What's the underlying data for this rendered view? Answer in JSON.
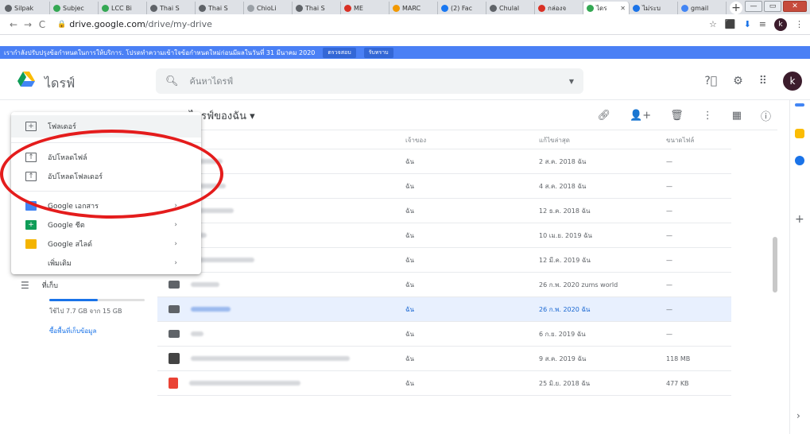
{
  "browser": {
    "tabs": [
      {
        "label": "Silpak",
        "color": "#5f6368"
      },
      {
        "label": "Subjec",
        "color": "#34a853"
      },
      {
        "label": "LCC Bi",
        "color": "#34a853"
      },
      {
        "label": "Thai S",
        "color": "#5f6368"
      },
      {
        "label": "Thai S",
        "color": "#5f6368"
      },
      {
        "label": "ChioLi",
        "color": "#9aa0a6"
      },
      {
        "label": "Thai S",
        "color": "#5f6368"
      },
      {
        "label": "ME",
        "color": "#d93025"
      },
      {
        "label": "MARC",
        "color": "#f29900"
      },
      {
        "label": "(2) Fac",
        "color": "#1877f2"
      },
      {
        "label": "Chulal",
        "color": "#5f6368"
      },
      {
        "label": "กล่องจ",
        "color": "#d93025"
      },
      {
        "label": "ไดร",
        "color": "#34a853"
      },
      {
        "label": "ไม่ระบ",
        "color": "#1a73e8"
      },
      {
        "label": "gmail",
        "color": "#4285f4"
      }
    ],
    "url_host": "drive.google.com",
    "url_path": "/drive/my-drive",
    "profile_letter": "k"
  },
  "notice": {
    "text": "เรากำลังปรับปรุงข้อกำหนดในการให้บริการ. โปรดทำความเข้าใจข้อกำหนดใหม่ก่อนมีผลในวันที่ 31 มีนาคม 2020",
    "review_label": "ตรวจสอบ",
    "dismiss_label": "รับทราบ"
  },
  "header": {
    "title": "ไดรฟ์",
    "search_placeholder": "ค้นหาไดรฟ์",
    "avatar_letter": "k"
  },
  "toolbar": {
    "breadcrumb": "ไดรฟ์ของฉัน"
  },
  "table": {
    "col_owner": "เจ้าของ",
    "col_modified": "แก้ไขล่าสุด",
    "col_size": "ขนาดไฟล์",
    "rows": [
      {
        "owner": "ฉัน",
        "modified": "2 ส.ค. 2018 ฉัน",
        "size": "—"
      },
      {
        "owner": "ฉัน",
        "modified": "4 ส.ค. 2018 ฉัน",
        "size": "—"
      },
      {
        "owner": "ฉัน",
        "modified": "12 ธ.ค. 2018 ฉัน",
        "size": "—"
      },
      {
        "owner": "ฉัน",
        "modified": "10 เม.ย. 2019 ฉัน",
        "size": "—"
      },
      {
        "owner": "ฉัน",
        "modified": "12 มี.ค. 2019 ฉัน",
        "size": "—"
      },
      {
        "owner": "ฉัน",
        "modified": "26 ก.พ. 2020 zums world",
        "size": "—"
      },
      {
        "owner": "ฉัน",
        "modified": "26 ก.พ. 2020 ฉัน",
        "size": "—"
      },
      {
        "owner": "ฉัน",
        "modified": "6 ก.ย. 2019 ฉัน",
        "size": "—"
      },
      {
        "owner": "ฉัน",
        "modified": "9 ส.ค. 2019 ฉัน",
        "size": "118 MB"
      },
      {
        "owner": "ฉัน",
        "modified": "25 มิ.ย. 2018 ฉัน",
        "size": "477 KB"
      }
    ]
  },
  "storage": {
    "label": "ที่เก็บ",
    "used_text": "ใช้ไป 7.7 GB จาก 15 GB",
    "used_fraction": 0.51,
    "buy_link": "ซื้อพื้นที่เก็บข้อมูล"
  },
  "menu": {
    "items": [
      {
        "label": "โฟลเดอร์"
      },
      {
        "label": "อัปโหลดไฟล์"
      },
      {
        "label": "อัปโหลดโฟลเดอร์"
      },
      {
        "label": "Google เอกสาร"
      },
      {
        "label": "Google ชีต"
      },
      {
        "label": "Google สไลด์"
      },
      {
        "label": "เพิ่มเติม"
      }
    ]
  },
  "colors": {
    "accent": "#1a73e8",
    "notice_bg": "#4a80f5",
    "annotation": "#e41c1c",
    "selected_row": "#e8f0fe"
  }
}
